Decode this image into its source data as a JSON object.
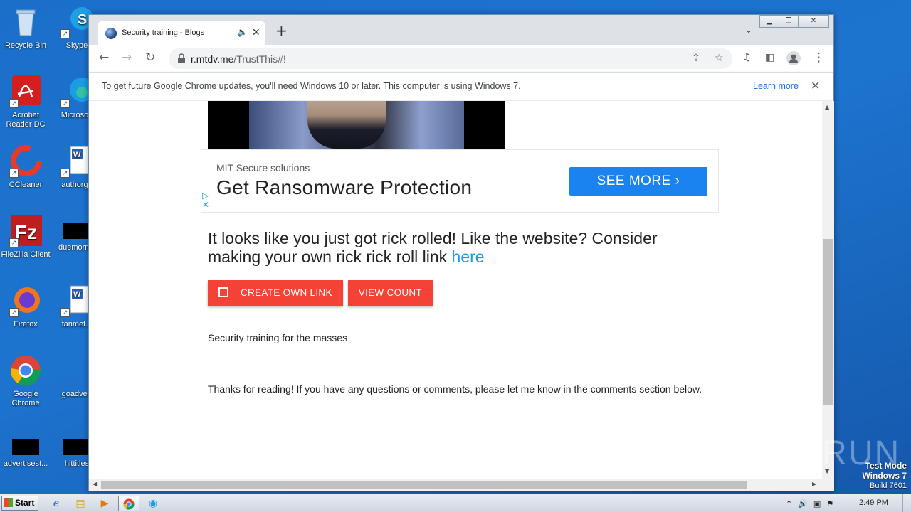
{
  "desktop": {
    "icons": [
      {
        "label": "Recycle Bin",
        "icon": "recycle-bin-icon"
      },
      {
        "label": "Skype",
        "icon": "skype-icon"
      },
      {
        "label": "Acrobat Reader DC",
        "icon": "acrobat-icon"
      },
      {
        "label": "Microsoft",
        "icon": "edge-icon"
      },
      {
        "label": "CCleaner",
        "icon": "ccleaner-icon"
      },
      {
        "label": "authorgo",
        "icon": "word-doc-icon"
      },
      {
        "label": "FileZilla Client",
        "icon": "filezilla-icon"
      },
      {
        "label": "duemornin",
        "icon": "file-icon"
      },
      {
        "label": "Firefox",
        "icon": "firefox-icon"
      },
      {
        "label": "fanmet...",
        "icon": "word-doc-icon"
      },
      {
        "label": "Google Chrome",
        "icon": "chrome-icon"
      },
      {
        "label": "goadvert",
        "icon": "file-icon"
      },
      {
        "label": "advertisest...",
        "icon": "file-icon"
      },
      {
        "label": "hittitles",
        "icon": "file-icon"
      }
    ]
  },
  "browser": {
    "tab": {
      "title": "Security training - Blogs",
      "audio_glyph": "🔈",
      "close_glyph": "✕"
    },
    "new_tab_glyph": "+",
    "url": {
      "host": "r.mtdv.me",
      "path": "/TrustThis#!"
    },
    "infobar": {
      "message": "To get future Google Chrome updates, you'll need Windows 10 or later. This computer is using Windows 7.",
      "link": "Learn more"
    }
  },
  "page": {
    "ad": {
      "brand": "MIT Secure solutions",
      "headline": "Get Ransomware Protection",
      "cta": "SEE MORE"
    },
    "lead_text": "It looks like you just got rick rolled! Like the website? Consider making your own rick rick roll link ",
    "lead_link": "here",
    "buttons": {
      "create": "CREATE OWN LINK",
      "view": "VIEW COUNT"
    },
    "tagline": "Security training for the masses",
    "thanks": "Thanks for reading! If you have any questions or comments, please let me know in the comments section below."
  },
  "taskbar": {
    "start": "Start",
    "clock": "2:49 PM"
  },
  "watermark": "ANY RUN",
  "os_notice": {
    "line1": "Test Mode",
    "line2": "Windows 7",
    "line3": "Build 7601"
  },
  "colors": {
    "accent_red": "#f44336",
    "link_blue": "#1a9be6",
    "cta_blue": "#1a83f0"
  }
}
